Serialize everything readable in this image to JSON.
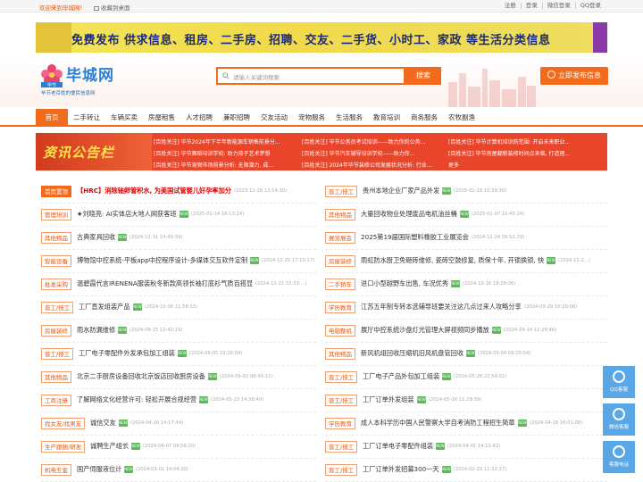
{
  "topbar": {
    "welcome": "欢迎来到毕城网!",
    "favorite": "收藏到桌面",
    "links": [
      "注册",
      "登录",
      "微信登录",
      "QQ登录"
    ]
  },
  "banner": {
    "text": "免费发布 供求信息、租房、二手房、招聘、交友、二手货、小时工、家政 等生活分类信息"
  },
  "header": {
    "logo_name": "毕城网",
    "logo_sub": "毕节老百姓的便民信息网",
    "logo_region": "毕节",
    "search_placeholder": "请输入关键词搜索",
    "search_button": "搜索",
    "post_button": "立即发布信息"
  },
  "nav": [
    "首页",
    "二手转让",
    "车辆买卖",
    "房屋租售",
    "人才招聘",
    "兼职招聘",
    "交友活动",
    "宠物服务",
    "生活服务",
    "教育培训",
    "商务服务",
    "农牧副渔"
  ],
  "notice": {
    "title": "资讯公告栏",
    "items": [
      "[百姓关注] 毕节2024年下半年新能源车销售前景分...",
      "[百姓关注] 毕节公务员考试培训——助力你的公务...",
      "[百姓关注] 毕节计算机培训的范围: 开启未来职业...",
      "[百姓关注] 毕节舞蹈培训学校: 助力孩子艺术梦想",
      "[百姓关注] 毕节汽车辅导培训学校——助力你...",
      "[百姓关注] 毕节房屋翻新装修时间点来临, 打造理...",
      "[百姓关注] 毕节宠物市场前景分析: 无限潜力, 成...",
      "[百姓关注] 2024年毕节装修公司发展状况分析: 行业...",
      "更多"
    ]
  },
  "badge_text": "NEW",
  "left_list": [
    {
      "tag": "首页置顶",
      "solid": true,
      "title": "【HRC】消除轴卵管积水, 为美国试管婴儿好孕率加分",
      "red": true,
      "date": "(2023-11-28 13:14:30)",
      "badge": false
    },
    {
      "tag": "管理培训",
      "title": "★刘晓亮: AI实体店大地人网获客班",
      "date": "(2025-01-14 16:13:24)",
      "badge": true
    },
    {
      "tag": "其他物品",
      "title": "古典家具回收",
      "date": "(2024-12-31 14:49:39)",
      "badge": true
    },
    {
      "tag": "智能设备",
      "title": "博物馆中控系统-平板app中控程序设计-多媒体交互软件定制",
      "date": "(2024-11-25 17:10:17)",
      "badge": true
    },
    {
      "tag": "批发采购",
      "title": "温碧霞代言IRENENA服装秋冬新款高领长袖打底衫气质百搭显",
      "date": "(2024-11-21 15:33:...)",
      "badge": false
    },
    {
      "tag": "普工/技工",
      "title": "工厂直发组装产品",
      "date": "(2024-10-06 11:58:15)",
      "badge": true
    },
    {
      "tag": "房屋装修",
      "title": "雨水防漏维修",
      "date": "(2024-09-15 12:42:29)",
      "badge": true
    },
    {
      "tag": "普工/技工",
      "title": "工厂电子零配件外发承包加工组装",
      "date": "(2024-09-05 10:28:09)",
      "badge": true
    },
    {
      "tag": "其他物品",
      "title": "北京二手厨房设备回收北京饭店回收厨房设备",
      "date": "(2024-09-02 08:49:11)",
      "badge": true
    },
    {
      "tag": "工商注册",
      "title": "了解网络文化经营许可: 轻松开展合规经营",
      "date": "(2024-05-23 14:38:49)",
      "badge": true
    },
    {
      "tag": "找女友/找男友",
      "title": "诚信交友",
      "date": "(2024-04-20 14:17:44)",
      "badge": true
    },
    {
      "tag": "生产跟随/研发",
      "title": "诚聘生产组长",
      "date": "(2024-04-07 09:56:20)",
      "badge": true
    },
    {
      "tag": "机电五金",
      "title": "国产伺服液位计",
      "date": "(2024-03-01 14:04:20)",
      "badge": true
    }
  ],
  "right_list": [
    {
      "tag": "普工/技工",
      "title": "贵州本地企业厂家产品外发",
      "date": "(2025-02-18 10:39:30)",
      "badge": true
    },
    {
      "tag": "其他物品",
      "title": "大量回收物业处理废品电机油丝桶",
      "date": "(2025-01-07 10:45:24)",
      "badge": true
    },
    {
      "tag": "展览展会",
      "title": "2025第19届国际塑料橡胶工业展览会",
      "date": "(2024-12-24 09:52:29)",
      "badge": false
    },
    {
      "tag": "房屋装修",
      "title": "雨虹防水厨卫免砸砖维修, 瓷砖空鼓修复, 质保十年, 开锁换锁, 快",
      "date": "(2024-11-2...)",
      "badge": true
    },
    {
      "tag": "二手轿车",
      "title": "进口小型越野车出售, 车况优秀",
      "date": "(2024-10-16 19:28:06)",
      "badge": true
    },
    {
      "tag": "学历教育",
      "title": "江苏五年制专转本选辅导班要关注这几点过来人攻略分享",
      "date": "(2024-09-29 10:20:06)",
      "badge": false
    },
    {
      "tag": "电脑整机",
      "title": "展厅中控系统沙盘灯光管理大屏视频同步播放",
      "date": "(2024-09-14 11:28:46)",
      "badge": true
    },
    {
      "tag": "其他物品",
      "title": "新风机组回收压缩机旧风机盘管回收",
      "date": "(2024-09-04 09:25:04)",
      "badge": true
    },
    {
      "tag": "普工/技工",
      "title": "工厂电子产品外包加工组装",
      "date": "(2024-05-28 22:54:01)",
      "badge": true
    },
    {
      "tag": "普工/技工",
      "title": "工厂订单外发组装",
      "date": "(2024-05-16 11:29:39)",
      "badge": true
    },
    {
      "tag": "学历教育",
      "title": "成人本科学历中国人民警察大学自考消防工程招生简章",
      "date": "(2024-04-18 16:01:08)",
      "badge": true
    },
    {
      "tag": "普工/技工",
      "title": "工厂订单电子零配件组装",
      "date": "(2024-04-01 14:12:42)",
      "badge": true
    },
    {
      "tag": "普工/技工",
      "title": "工厂订单外发招募300一天",
      "date": "(2024-02-20 11:32:37)",
      "badge": true
    }
  ],
  "side": [
    "QQ客服",
    "微信客服",
    "客服电话"
  ]
}
